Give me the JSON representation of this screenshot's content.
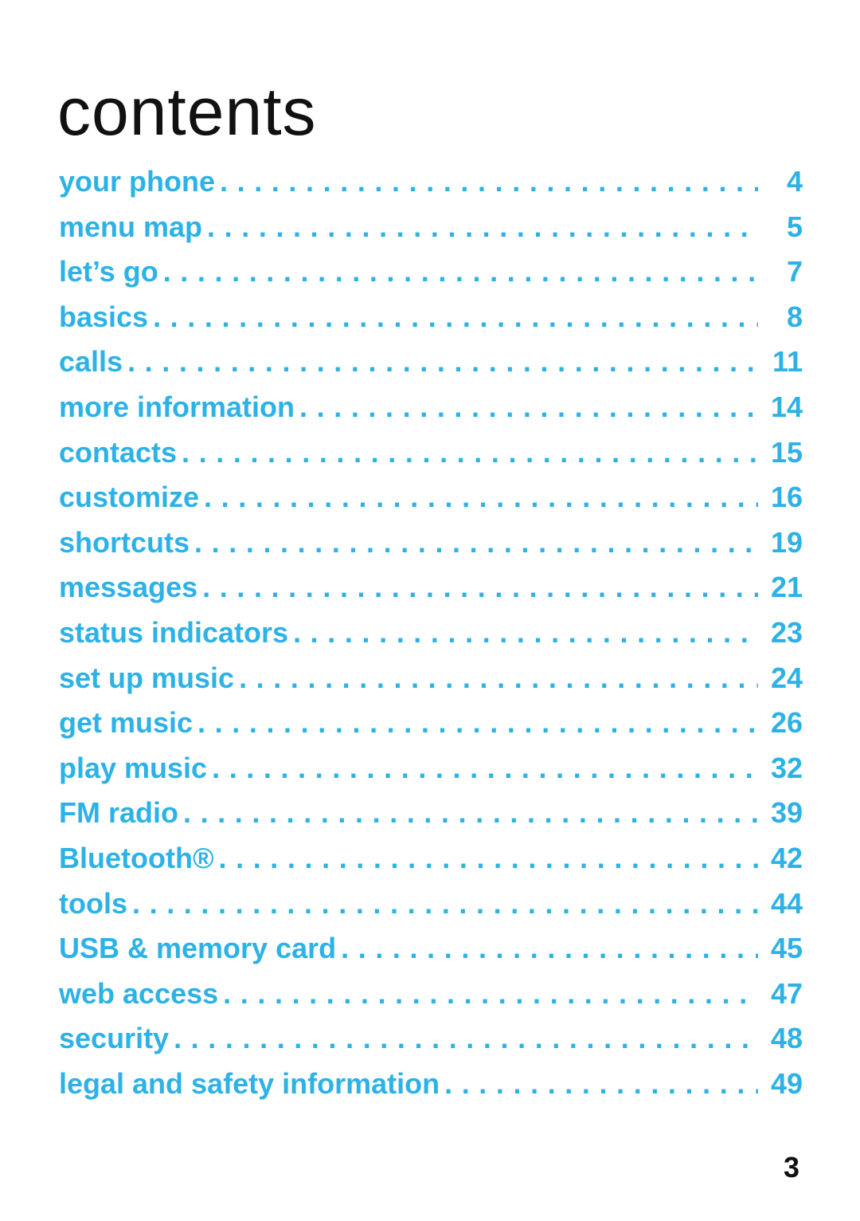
{
  "title": "contents",
  "accent_color": "#2cb2e6",
  "toc": [
    {
      "label": "your phone",
      "page": "4"
    },
    {
      "label": "menu map",
      "page": "5"
    },
    {
      "label": "let’s go",
      "page": "7"
    },
    {
      "label": "basics",
      "page": "8"
    },
    {
      "label": "calls",
      "page": "11"
    },
    {
      "label": "more information",
      "page": "14"
    },
    {
      "label": "contacts",
      "page": "15"
    },
    {
      "label": "customize",
      "page": "16"
    },
    {
      "label": "shortcuts",
      "page": "19"
    },
    {
      "label": "messages",
      "page": "21"
    },
    {
      "label": "status indicators",
      "page": "23"
    },
    {
      "label": "set up music",
      "page": "24"
    },
    {
      "label": "get music",
      "page": "26"
    },
    {
      "label": "play music",
      "page": "32"
    },
    {
      "label": "FM radio",
      "page": "39"
    },
    {
      "label": "Bluetooth®",
      "page": "42"
    },
    {
      "label": "tools",
      "page": "44"
    },
    {
      "label": "USB & memory card",
      "page": "45"
    },
    {
      "label": "web access",
      "page": "47"
    },
    {
      "label": "security",
      "page": "48"
    },
    {
      "label": "legal and safety information",
      "page": "49"
    }
  ],
  "page_number": "3"
}
